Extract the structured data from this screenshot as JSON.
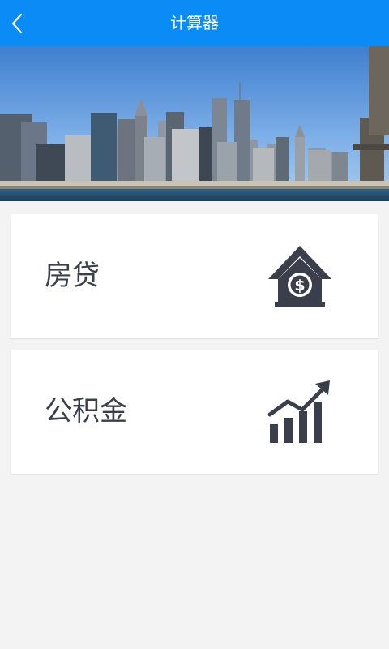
{
  "header": {
    "title": "计算器"
  },
  "menu": [
    {
      "label": "房贷",
      "icon": "house-dollar-icon"
    },
    {
      "label": "公积金",
      "icon": "growth-chart-icon"
    }
  ],
  "colors": {
    "accent": "#0a8bf5",
    "background": "#f3f3f3",
    "card": "#ffffff",
    "text": "#3a3f4b",
    "icon": "#3a3f4b"
  }
}
